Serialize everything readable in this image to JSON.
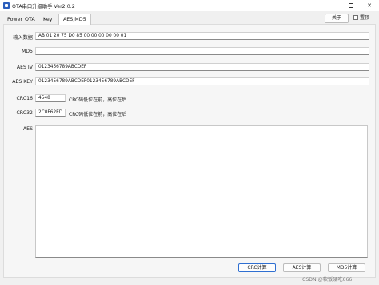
{
  "window": {
    "title": "OTA串口升级助手 Ver2.0.2",
    "minimize_glyph": "—",
    "close_glyph": "✕"
  },
  "tabs": [
    {
      "label": "Power"
    },
    {
      "label": "OTA"
    },
    {
      "label": "Key"
    },
    {
      "label": "AES,MD5",
      "active": true
    }
  ],
  "toolbar": {
    "about_label": "关于",
    "pin_label": "置顶",
    "pin_checked": false
  },
  "form": {
    "input_label": "输入数据",
    "input_value": "AB 01 20 75 D0 85 00 00 00 00 00 01",
    "md5_label": "MD5",
    "md5_value": "",
    "aes_iv_label": "AES IV",
    "aes_iv_value": "0123456789ABCDEF",
    "aes_key_label": "AES KEY",
    "aes_key_value": "0123456789ABCDEF0123456789ABCDEF",
    "crc16_label": "CRC16",
    "crc16_value": "4548",
    "crc16_note": "CRC码低位在前，高位在后",
    "crc32_label": "CRC32",
    "crc32_value": "2C0F62ED",
    "crc32_note": "CRC码低位在前，高位在后",
    "aes_output_label": "AES",
    "aes_output_value": ""
  },
  "buttons": {
    "crc_label": "CRC计算",
    "aes_label": "AES计算",
    "md5_label": "MD5计算"
  },
  "watermark": "CSDN @软饭硬吃666",
  "colors": {
    "accent": "#2f6fd1",
    "background": "#f0f0f0"
  }
}
